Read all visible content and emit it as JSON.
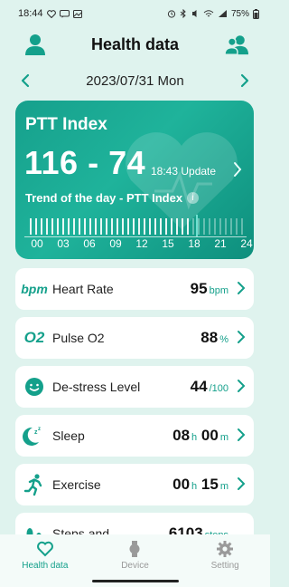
{
  "status": {
    "time": "18:44",
    "battery": "75%"
  },
  "header": {
    "title": "Health data"
  },
  "date": {
    "label": "2023/07/31 Mon"
  },
  "ptt": {
    "title": "PTT Index",
    "value": "116 - 74",
    "update": "18:43 Update",
    "trend_label": "Trend of the day - PTT Index",
    "ticks": [
      "00",
      "03",
      "06",
      "09",
      "12",
      "15",
      "18",
      "21",
      "24"
    ]
  },
  "metrics": [
    {
      "icon": "bpm-icon",
      "icon_text": "bpm",
      "label": "Heart Rate",
      "value": "95",
      "unit": "bpm"
    },
    {
      "icon": "o2-icon",
      "icon_text": "O2",
      "label": "Pulse O2",
      "value": "88",
      "unit": "%"
    },
    {
      "icon": "smile-icon",
      "label": "De-stress Level",
      "value": "44",
      "unit": "/100"
    },
    {
      "icon": "sleep-icon",
      "label": "Sleep",
      "value_h": "08",
      "unit_h": "h",
      "value_m": "00",
      "unit_m": "m"
    },
    {
      "icon": "running-icon",
      "label": "Exercise",
      "value_h": "00",
      "unit_h": "h",
      "value_m": "15",
      "unit_m": "m"
    },
    {
      "icon": "footsteps-icon",
      "label": "Steps and",
      "value": "6103",
      "unit": "steps"
    }
  ],
  "nav": {
    "items": [
      {
        "label": "Health data",
        "icon": "heart-icon"
      },
      {
        "label": "Device",
        "icon": "watch-icon"
      },
      {
        "label": "Setting",
        "icon": "gear-icon"
      }
    ]
  },
  "colors": {
    "accent": "#14a08b",
    "background": "#dff3ee",
    "card": "#ffffff"
  }
}
